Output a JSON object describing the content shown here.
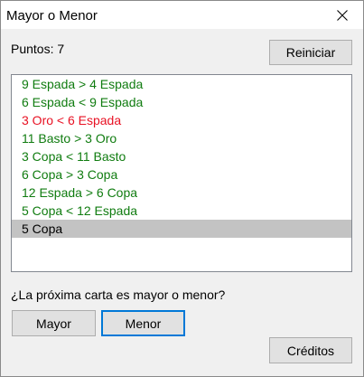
{
  "window": {
    "title": "Mayor o Menor"
  },
  "score": {
    "label": "Puntos: 7"
  },
  "buttons": {
    "reset": "Reiniciar",
    "mayor": "Mayor",
    "menor": "Menor",
    "credits": "Créditos"
  },
  "question": "¿La próxima carta es mayor o menor?",
  "colors": {
    "correct": "#107c10",
    "wrong": "#e81123",
    "neutral": "#000000",
    "selection": "#c3c3c3",
    "focus": "#0078d7"
  },
  "history": [
    {
      "text": "9 Espada > 4 Espada",
      "status": "correct"
    },
    {
      "text": "6 Espada < 9 Espada",
      "status": "correct"
    },
    {
      "text": "3 Oro < 6 Espada",
      "status": "wrong"
    },
    {
      "text": "11 Basto > 3 Oro",
      "status": "correct"
    },
    {
      "text": "3 Copa < 11 Basto",
      "status": "correct"
    },
    {
      "text": "6 Copa > 3 Copa",
      "status": "correct"
    },
    {
      "text": "12 Espada > 6 Copa",
      "status": "correct"
    },
    {
      "text": "5 Copa < 12 Espada",
      "status": "correct"
    },
    {
      "text": "5 Copa",
      "status": "current"
    }
  ]
}
